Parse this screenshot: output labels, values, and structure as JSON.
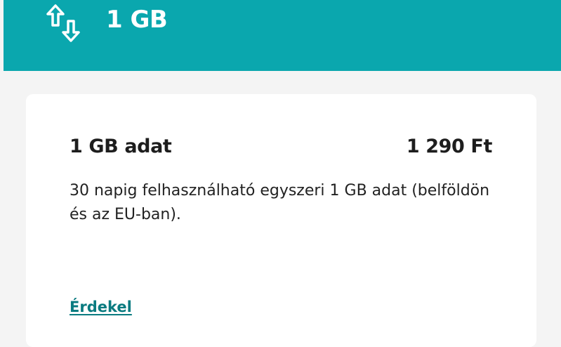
{
  "header": {
    "title": "1 GB",
    "icon": "data-transfer-arrows-icon",
    "background_color": "#0aa7ae"
  },
  "card": {
    "title": "1 GB adat",
    "price": "1 290 Ft",
    "description": "30 napig felhasználható egyszeri 1 GB adat (belföldön és az EU-ban).",
    "link_label": "Érdekel",
    "link_color": "#0a7b80"
  }
}
